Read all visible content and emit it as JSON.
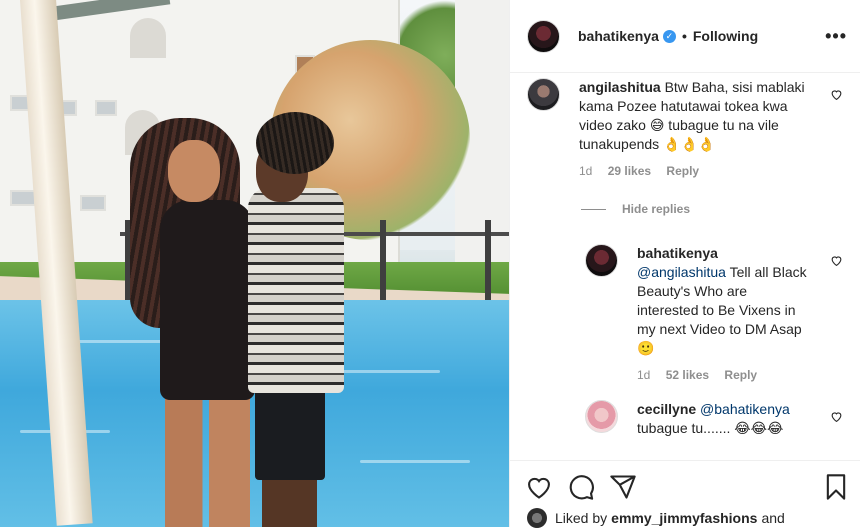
{
  "header": {
    "username": "bahatikenya",
    "verified_glyph": "✓",
    "separator": "•",
    "follow_status": "Following",
    "more_label": "•••"
  },
  "comments": [
    {
      "username": "angilashitua",
      "text": "Btw Baha, sisi mablaki kama Pozee hatutawai tokea kwa video zako 😅 tubague tu na vile tunakupends 👌👌👌",
      "time": "1d",
      "likes": "29 likes",
      "reply_label": "Reply"
    }
  ],
  "hide_replies_label": "Hide replies",
  "replies": [
    {
      "username": "bahatikenya",
      "mention": "@angilashitua",
      "text": "Tell all Black Beauty's Who are interested to Be Vixens in my next Video to DM Asap 🙂",
      "time": "1d",
      "likes": "52 likes",
      "reply_label": "Reply"
    },
    {
      "username": "cecillyne",
      "mention": "@bahatikenya",
      "text": "tubague tu....... 😂😂😂"
    }
  ],
  "liked_by": {
    "prefix": "Liked by",
    "user": "emmy_jimmyfashions",
    "suffix": "and"
  },
  "icons": {
    "heart": "heart-icon",
    "comment": "comment-icon",
    "share": "share-icon",
    "save": "bookmark-icon",
    "more": "more-icon"
  },
  "colors": {
    "verified": "#3897f0",
    "mention": "#00376b",
    "secondary_text": "#8e8e8e"
  }
}
